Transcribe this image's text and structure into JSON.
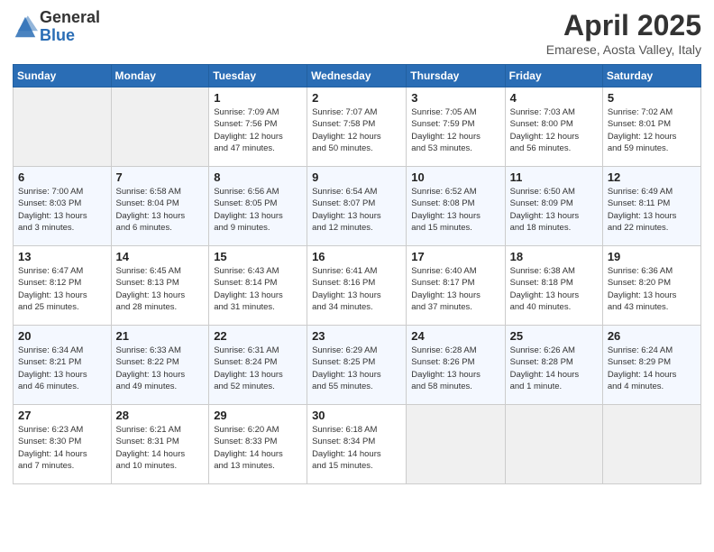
{
  "header": {
    "logo_general": "General",
    "logo_blue": "Blue",
    "title": "April 2025",
    "subtitle": "Emarese, Aosta Valley, Italy"
  },
  "weekdays": [
    "Sunday",
    "Monday",
    "Tuesday",
    "Wednesday",
    "Thursday",
    "Friday",
    "Saturday"
  ],
  "weeks": [
    {
      "days": [
        {
          "num": "",
          "info": ""
        },
        {
          "num": "",
          "info": ""
        },
        {
          "num": "1",
          "info": "Sunrise: 7:09 AM\nSunset: 7:56 PM\nDaylight: 12 hours\nand 47 minutes."
        },
        {
          "num": "2",
          "info": "Sunrise: 7:07 AM\nSunset: 7:58 PM\nDaylight: 12 hours\nand 50 minutes."
        },
        {
          "num": "3",
          "info": "Sunrise: 7:05 AM\nSunset: 7:59 PM\nDaylight: 12 hours\nand 53 minutes."
        },
        {
          "num": "4",
          "info": "Sunrise: 7:03 AM\nSunset: 8:00 PM\nDaylight: 12 hours\nand 56 minutes."
        },
        {
          "num": "5",
          "info": "Sunrise: 7:02 AM\nSunset: 8:01 PM\nDaylight: 12 hours\nand 59 minutes."
        }
      ]
    },
    {
      "days": [
        {
          "num": "6",
          "info": "Sunrise: 7:00 AM\nSunset: 8:03 PM\nDaylight: 13 hours\nand 3 minutes."
        },
        {
          "num": "7",
          "info": "Sunrise: 6:58 AM\nSunset: 8:04 PM\nDaylight: 13 hours\nand 6 minutes."
        },
        {
          "num": "8",
          "info": "Sunrise: 6:56 AM\nSunset: 8:05 PM\nDaylight: 13 hours\nand 9 minutes."
        },
        {
          "num": "9",
          "info": "Sunrise: 6:54 AM\nSunset: 8:07 PM\nDaylight: 13 hours\nand 12 minutes."
        },
        {
          "num": "10",
          "info": "Sunrise: 6:52 AM\nSunset: 8:08 PM\nDaylight: 13 hours\nand 15 minutes."
        },
        {
          "num": "11",
          "info": "Sunrise: 6:50 AM\nSunset: 8:09 PM\nDaylight: 13 hours\nand 18 minutes."
        },
        {
          "num": "12",
          "info": "Sunrise: 6:49 AM\nSunset: 8:11 PM\nDaylight: 13 hours\nand 22 minutes."
        }
      ]
    },
    {
      "days": [
        {
          "num": "13",
          "info": "Sunrise: 6:47 AM\nSunset: 8:12 PM\nDaylight: 13 hours\nand 25 minutes."
        },
        {
          "num": "14",
          "info": "Sunrise: 6:45 AM\nSunset: 8:13 PM\nDaylight: 13 hours\nand 28 minutes."
        },
        {
          "num": "15",
          "info": "Sunrise: 6:43 AM\nSunset: 8:14 PM\nDaylight: 13 hours\nand 31 minutes."
        },
        {
          "num": "16",
          "info": "Sunrise: 6:41 AM\nSunset: 8:16 PM\nDaylight: 13 hours\nand 34 minutes."
        },
        {
          "num": "17",
          "info": "Sunrise: 6:40 AM\nSunset: 8:17 PM\nDaylight: 13 hours\nand 37 minutes."
        },
        {
          "num": "18",
          "info": "Sunrise: 6:38 AM\nSunset: 8:18 PM\nDaylight: 13 hours\nand 40 minutes."
        },
        {
          "num": "19",
          "info": "Sunrise: 6:36 AM\nSunset: 8:20 PM\nDaylight: 13 hours\nand 43 minutes."
        }
      ]
    },
    {
      "days": [
        {
          "num": "20",
          "info": "Sunrise: 6:34 AM\nSunset: 8:21 PM\nDaylight: 13 hours\nand 46 minutes."
        },
        {
          "num": "21",
          "info": "Sunrise: 6:33 AM\nSunset: 8:22 PM\nDaylight: 13 hours\nand 49 minutes."
        },
        {
          "num": "22",
          "info": "Sunrise: 6:31 AM\nSunset: 8:24 PM\nDaylight: 13 hours\nand 52 minutes."
        },
        {
          "num": "23",
          "info": "Sunrise: 6:29 AM\nSunset: 8:25 PM\nDaylight: 13 hours\nand 55 minutes."
        },
        {
          "num": "24",
          "info": "Sunrise: 6:28 AM\nSunset: 8:26 PM\nDaylight: 13 hours\nand 58 minutes."
        },
        {
          "num": "25",
          "info": "Sunrise: 6:26 AM\nSunset: 8:28 PM\nDaylight: 14 hours\nand 1 minute."
        },
        {
          "num": "26",
          "info": "Sunrise: 6:24 AM\nSunset: 8:29 PM\nDaylight: 14 hours\nand 4 minutes."
        }
      ]
    },
    {
      "days": [
        {
          "num": "27",
          "info": "Sunrise: 6:23 AM\nSunset: 8:30 PM\nDaylight: 14 hours\nand 7 minutes."
        },
        {
          "num": "28",
          "info": "Sunrise: 6:21 AM\nSunset: 8:31 PM\nDaylight: 14 hours\nand 10 minutes."
        },
        {
          "num": "29",
          "info": "Sunrise: 6:20 AM\nSunset: 8:33 PM\nDaylight: 14 hours\nand 13 minutes."
        },
        {
          "num": "30",
          "info": "Sunrise: 6:18 AM\nSunset: 8:34 PM\nDaylight: 14 hours\nand 15 minutes."
        },
        {
          "num": "",
          "info": ""
        },
        {
          "num": "",
          "info": ""
        },
        {
          "num": "",
          "info": ""
        }
      ]
    }
  ]
}
